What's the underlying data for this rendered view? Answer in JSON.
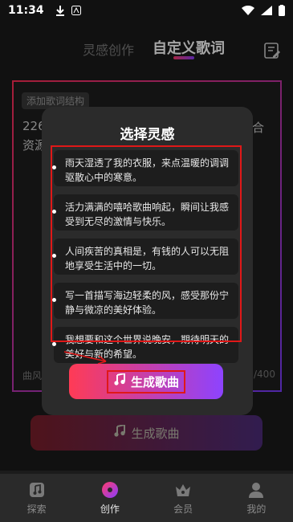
{
  "status_bar": {
    "time": "11:34"
  },
  "header": {
    "tab_inspiration": "灵感创作",
    "tab_custom": "自定义歌词"
  },
  "background_card": {
    "chip": "添加歌词结构",
    "text_line1": "226",
    "text_line2": "资源",
    "text_right": "合",
    "bottom_left": "曲风",
    "bottom_right": "/400"
  },
  "modal": {
    "title": "选择灵感",
    "items": [
      "雨天湿透了我的衣服，来点温暖的调调驱散心中的寒意。",
      "活力满满的嘻哈歌曲响起，瞬间让我感受到无尽的激情与快乐。",
      "人间疾苦的真相是，有钱的人可以无阻地享受生活中的一切。",
      "写一首描写海边轻柔的风，感受那份宁静与微凉的美好体验。",
      "我想要和这个世界说晚安，期待明天的美好与新的希望。"
    ],
    "generate_label": "生成歌曲"
  },
  "bottom_button": {
    "label": "生成歌曲"
  },
  "nav": {
    "explore": "探索",
    "create": "创作",
    "member": "会员",
    "mine": "我的"
  }
}
